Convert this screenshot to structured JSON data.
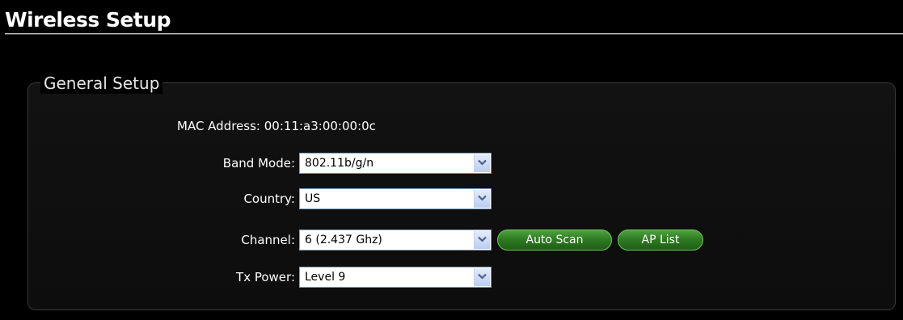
{
  "page": {
    "title": "Wireless Setup"
  },
  "general_setup": {
    "legend": "General Setup",
    "mac_address": {
      "label": "MAC Address:",
      "value": "00:11:a3:00:00:0c"
    },
    "band_mode": {
      "label": "Band Mode:",
      "value": "802.11b/g/n"
    },
    "country": {
      "label": "Country:",
      "value": "US"
    },
    "channel": {
      "label": "Channel:",
      "value": "6 (2.437 Ghz)"
    },
    "tx_power": {
      "label": "Tx Power:",
      "value": "Level 9"
    },
    "buttons": {
      "auto_scan": "Auto Scan",
      "ap_list": "AP List"
    }
  },
  "colors": {
    "background": "#000000",
    "button_green": "#2f7d23",
    "select_arrow": "#b9cdf3"
  },
  "icons": {
    "select_arrow": "chevron-down-icon"
  }
}
